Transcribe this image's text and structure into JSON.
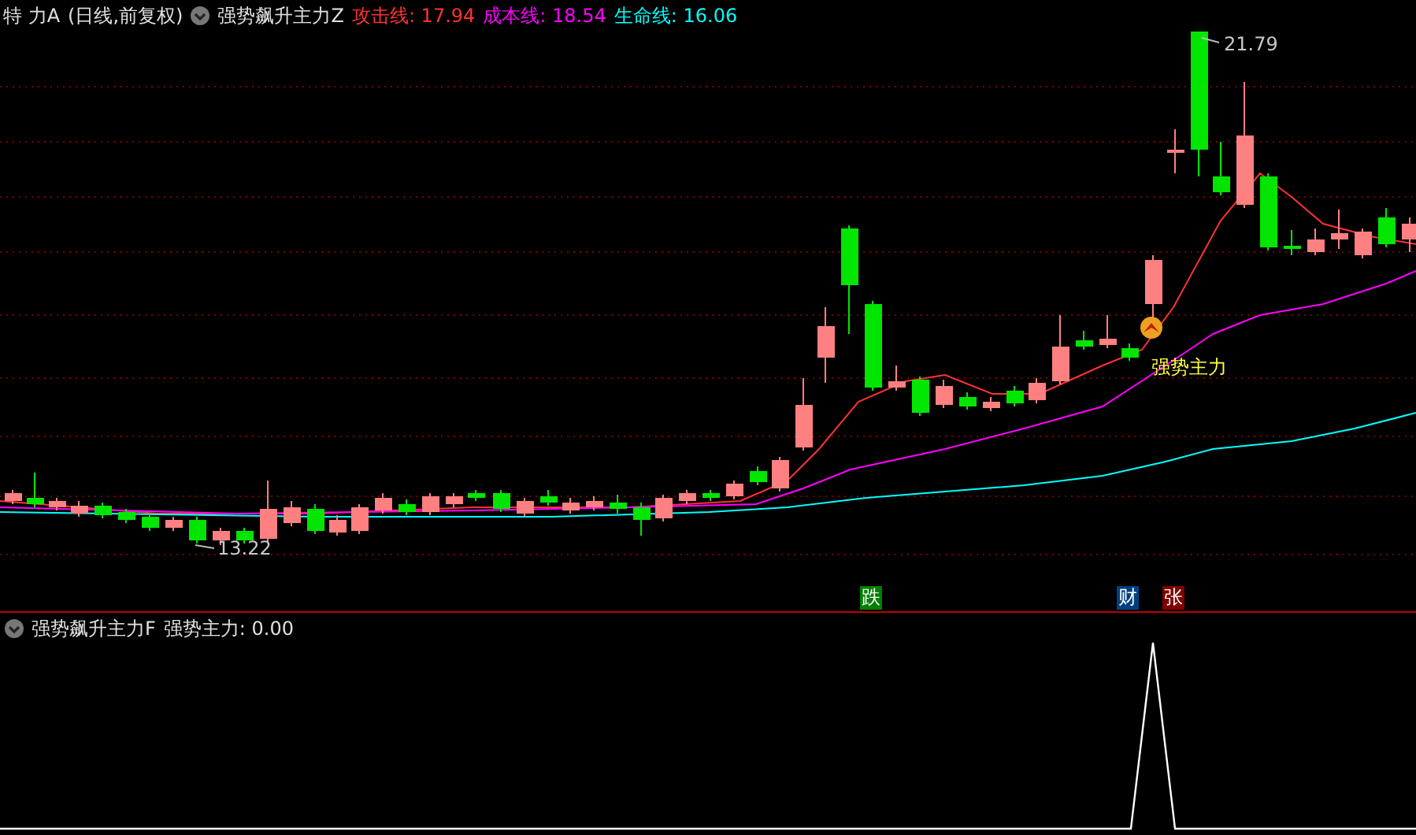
{
  "header": {
    "stock": "特 力A",
    "period": "(日线,前复权)",
    "indicator": "强势飙升主力Z",
    "legend": [
      {
        "text": "攻击线: 17.94",
        "color": "#ff3232"
      },
      {
        "text": "成本线: 18.54",
        "color": "#ff00ff"
      },
      {
        "text": "生命线: 16.06",
        "color": "#00ffff"
      }
    ]
  },
  "price_chart": {
    "high_label": "21.79",
    "low_label": "13.22",
    "signal_label": "强势主力"
  },
  "markers": [
    {
      "text": "跌",
      "color": "#008000"
    },
    {
      "text": "财",
      "color": "#004080"
    },
    {
      "text": "张",
      "color": "#800000"
    }
  ],
  "sub_panel": {
    "indicator": "强势飙升主力F",
    "reading": "强势主力: 0.00"
  }
}
